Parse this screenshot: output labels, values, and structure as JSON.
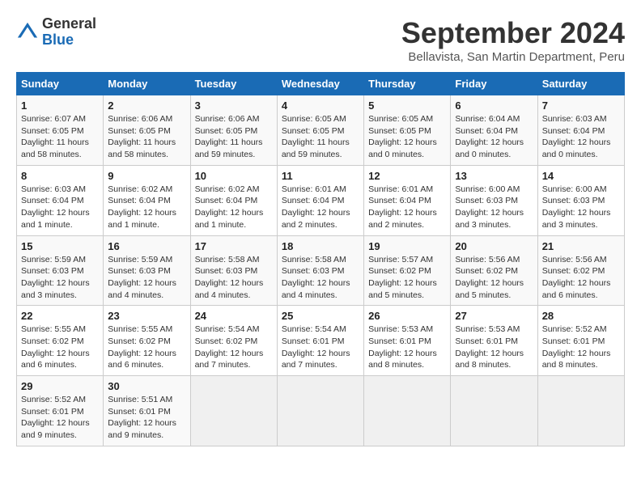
{
  "logo": {
    "general": "General",
    "blue": "Blue"
  },
  "title": "September 2024",
  "subtitle": "Bellavista, San Martin Department, Peru",
  "days_of_week": [
    "Sunday",
    "Monday",
    "Tuesday",
    "Wednesday",
    "Thursday",
    "Friday",
    "Saturday"
  ],
  "weeks": [
    [
      {
        "day": "1",
        "info": "Sunrise: 6:07 AM\nSunset: 6:05 PM\nDaylight: 11 hours\nand 58 minutes."
      },
      {
        "day": "2",
        "info": "Sunrise: 6:06 AM\nSunset: 6:05 PM\nDaylight: 11 hours\nand 58 minutes."
      },
      {
        "day": "3",
        "info": "Sunrise: 6:06 AM\nSunset: 6:05 PM\nDaylight: 11 hours\nand 59 minutes."
      },
      {
        "day": "4",
        "info": "Sunrise: 6:05 AM\nSunset: 6:05 PM\nDaylight: 11 hours\nand 59 minutes."
      },
      {
        "day": "5",
        "info": "Sunrise: 6:05 AM\nSunset: 6:05 PM\nDaylight: 12 hours\nand 0 minutes."
      },
      {
        "day": "6",
        "info": "Sunrise: 6:04 AM\nSunset: 6:04 PM\nDaylight: 12 hours\nand 0 minutes."
      },
      {
        "day": "7",
        "info": "Sunrise: 6:03 AM\nSunset: 6:04 PM\nDaylight: 12 hours\nand 0 minutes."
      }
    ],
    [
      {
        "day": "8",
        "info": "Sunrise: 6:03 AM\nSunset: 6:04 PM\nDaylight: 12 hours\nand 1 minute."
      },
      {
        "day": "9",
        "info": "Sunrise: 6:02 AM\nSunset: 6:04 PM\nDaylight: 12 hours\nand 1 minute."
      },
      {
        "day": "10",
        "info": "Sunrise: 6:02 AM\nSunset: 6:04 PM\nDaylight: 12 hours\nand 1 minute."
      },
      {
        "day": "11",
        "info": "Sunrise: 6:01 AM\nSunset: 6:04 PM\nDaylight: 12 hours\nand 2 minutes."
      },
      {
        "day": "12",
        "info": "Sunrise: 6:01 AM\nSunset: 6:04 PM\nDaylight: 12 hours\nand 2 minutes."
      },
      {
        "day": "13",
        "info": "Sunrise: 6:00 AM\nSunset: 6:03 PM\nDaylight: 12 hours\nand 3 minutes."
      },
      {
        "day": "14",
        "info": "Sunrise: 6:00 AM\nSunset: 6:03 PM\nDaylight: 12 hours\nand 3 minutes."
      }
    ],
    [
      {
        "day": "15",
        "info": "Sunrise: 5:59 AM\nSunset: 6:03 PM\nDaylight: 12 hours\nand 3 minutes."
      },
      {
        "day": "16",
        "info": "Sunrise: 5:59 AM\nSunset: 6:03 PM\nDaylight: 12 hours\nand 4 minutes."
      },
      {
        "day": "17",
        "info": "Sunrise: 5:58 AM\nSunset: 6:03 PM\nDaylight: 12 hours\nand 4 minutes."
      },
      {
        "day": "18",
        "info": "Sunrise: 5:58 AM\nSunset: 6:03 PM\nDaylight: 12 hours\nand 4 minutes."
      },
      {
        "day": "19",
        "info": "Sunrise: 5:57 AM\nSunset: 6:02 PM\nDaylight: 12 hours\nand 5 minutes."
      },
      {
        "day": "20",
        "info": "Sunrise: 5:56 AM\nSunset: 6:02 PM\nDaylight: 12 hours\nand 5 minutes."
      },
      {
        "day": "21",
        "info": "Sunrise: 5:56 AM\nSunset: 6:02 PM\nDaylight: 12 hours\nand 6 minutes."
      }
    ],
    [
      {
        "day": "22",
        "info": "Sunrise: 5:55 AM\nSunset: 6:02 PM\nDaylight: 12 hours\nand 6 minutes."
      },
      {
        "day": "23",
        "info": "Sunrise: 5:55 AM\nSunset: 6:02 PM\nDaylight: 12 hours\nand 6 minutes."
      },
      {
        "day": "24",
        "info": "Sunrise: 5:54 AM\nSunset: 6:02 PM\nDaylight: 12 hours\nand 7 minutes."
      },
      {
        "day": "25",
        "info": "Sunrise: 5:54 AM\nSunset: 6:01 PM\nDaylight: 12 hours\nand 7 minutes."
      },
      {
        "day": "26",
        "info": "Sunrise: 5:53 AM\nSunset: 6:01 PM\nDaylight: 12 hours\nand 8 minutes."
      },
      {
        "day": "27",
        "info": "Sunrise: 5:53 AM\nSunset: 6:01 PM\nDaylight: 12 hours\nand 8 minutes."
      },
      {
        "day": "28",
        "info": "Sunrise: 5:52 AM\nSunset: 6:01 PM\nDaylight: 12 hours\nand 8 minutes."
      }
    ],
    [
      {
        "day": "29",
        "info": "Sunrise: 5:52 AM\nSunset: 6:01 PM\nDaylight: 12 hours\nand 9 minutes."
      },
      {
        "day": "30",
        "info": "Sunrise: 5:51 AM\nSunset: 6:01 PM\nDaylight: 12 hours\nand 9 minutes."
      },
      {
        "day": "",
        "info": ""
      },
      {
        "day": "",
        "info": ""
      },
      {
        "day": "",
        "info": ""
      },
      {
        "day": "",
        "info": ""
      },
      {
        "day": "",
        "info": ""
      }
    ]
  ]
}
